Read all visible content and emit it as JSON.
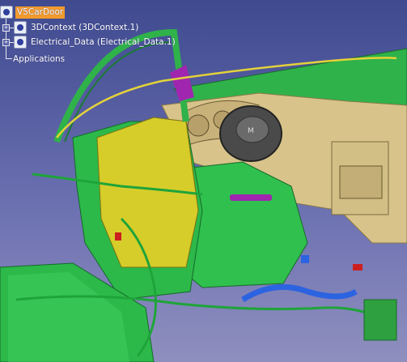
{
  "app": {
    "title": "V5CarDoor"
  },
  "spec_tree": {
    "root": {
      "label": "V5CarDoor",
      "icon": "product-gears-icon",
      "selected": true,
      "highlight_color": "#f39a2c"
    },
    "children": [
      {
        "label": "3DContext (3DContext.1)",
        "icon": "product-gears-icon"
      },
      {
        "label": "Electrical_Data (Electrical_Data.1)",
        "icon": "product-gears-icon"
      }
    ],
    "applications_label": "Applications"
  },
  "scene": {
    "description_colors": {
      "background_top": "#3f4a8f",
      "background_bottom": "#8f8fbf",
      "door_panel": "#2db84a",
      "door_trim": "#e6dc1e",
      "dashboard": "#d8c48a",
      "harness_yellow": "#e3d23a",
      "harness_blue": "#2b63e0",
      "steering_wheel": "#4a4a4a",
      "accent_magenta": "#a026b0",
      "connector_red": "#cc2020"
    }
  }
}
